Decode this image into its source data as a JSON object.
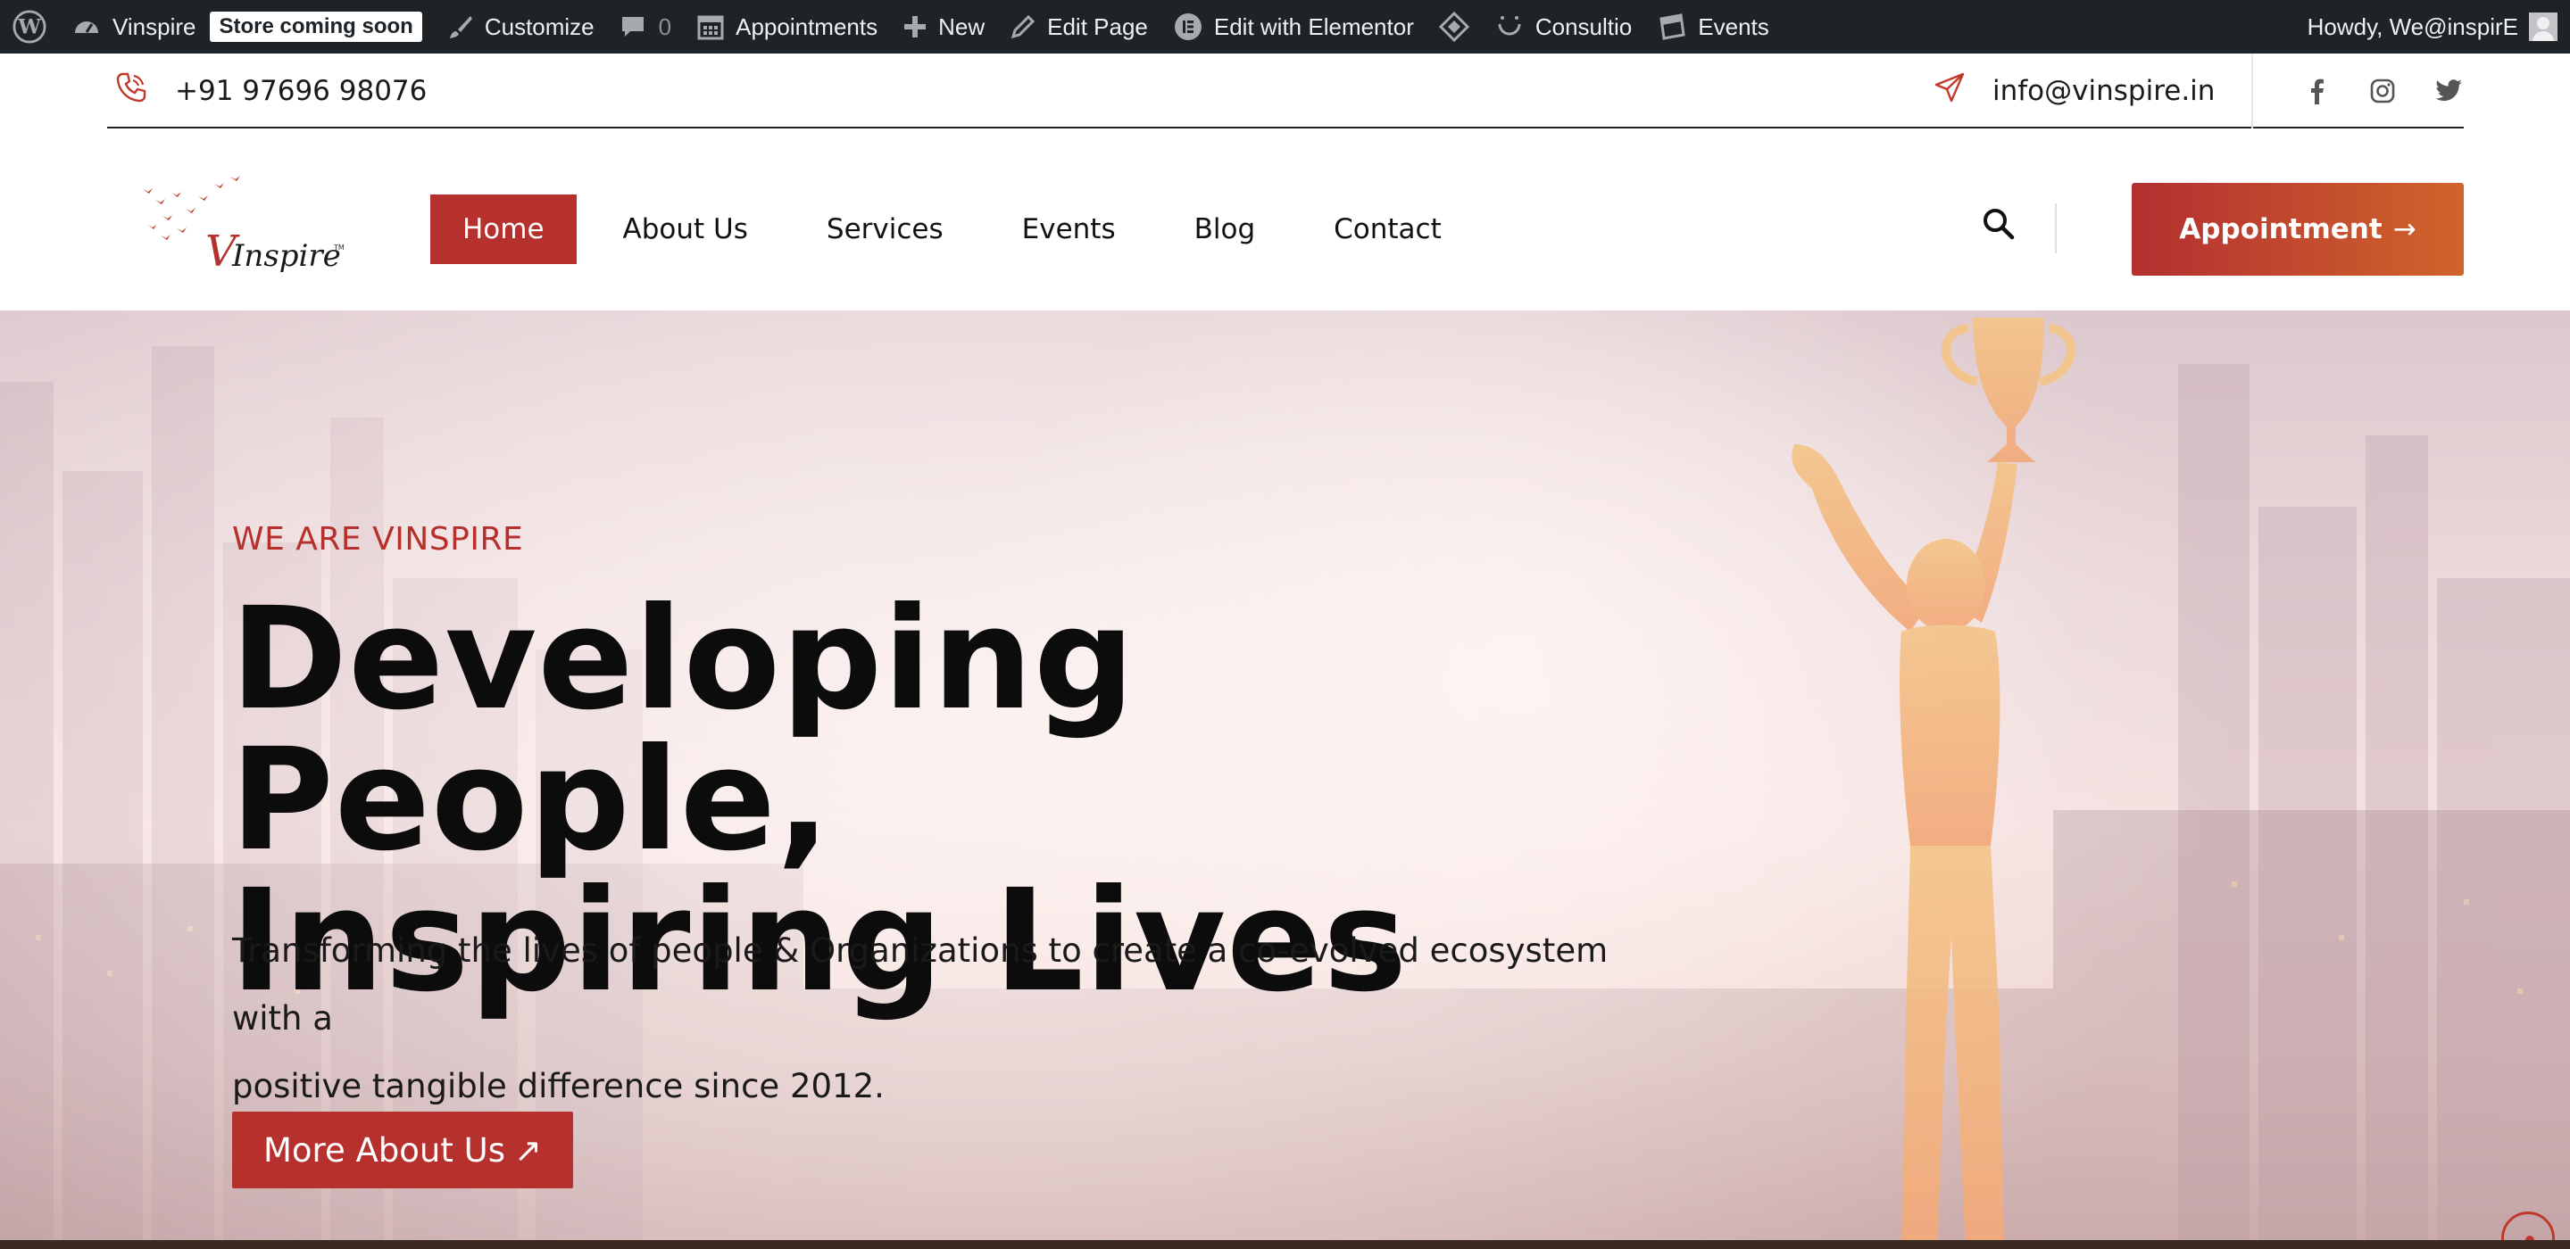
{
  "admin_bar": {
    "site_name": "Vinspire",
    "store_badge": "Store coming soon",
    "customize": "Customize",
    "comments_count": "0",
    "appointments": "Appointments",
    "new": "New",
    "edit_page": "Edit Page",
    "edit_elementor": "Edit with Elementor",
    "consultio": "Consultio",
    "events": "Events",
    "howdy": "Howdy, We@inspirE",
    "icons": [
      "wordpress-icon",
      "dashboard-icon",
      "brush-icon",
      "comment-icon",
      "calendar-icon",
      "plus-icon",
      "pencil-icon",
      "elementor-icon",
      "diamond-icon",
      "smile-icon",
      "events-icon"
    ]
  },
  "topbar": {
    "phone": "+91 97696 98076",
    "email": "info@vinspire.in",
    "social": [
      "facebook-icon",
      "instagram-icon",
      "twitter-icon"
    ]
  },
  "header": {
    "logo_text": "VInspire",
    "logo_tm": "TM",
    "nav": [
      {
        "label": "Home",
        "active": true
      },
      {
        "label": "About Us",
        "active": false
      },
      {
        "label": "Services",
        "active": false
      },
      {
        "label": "Events",
        "active": false
      },
      {
        "label": "Blog",
        "active": false
      },
      {
        "label": "Contact",
        "active": false
      }
    ],
    "appointment_label": "Appointment",
    "appointment_arrow": "→"
  },
  "hero": {
    "eyebrow": "WE ARE VINSPIRE",
    "title_line1": "Developing People,",
    "title_line2": "Inspiring Lives",
    "subtitle_line1": "Transforming the lives of people & Organizations to create a co-evolved ecosystem with a",
    "subtitle_line2": "positive tangible difference since 2012.",
    "button_label": "More About Us",
    "button_arrow": "↗"
  },
  "colors": {
    "brand_red": "#b6302d",
    "admin_bar_bg": "#1d2327",
    "gradient_end": "#d0642b"
  }
}
